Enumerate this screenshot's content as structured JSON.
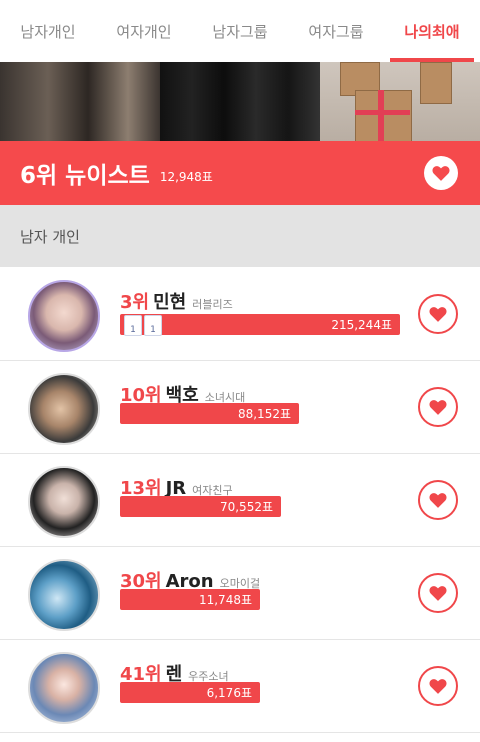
{
  "tabs": [
    {
      "label": "남자개인",
      "active": false
    },
    {
      "label": "여자개인",
      "active": false
    },
    {
      "label": "남자그룹",
      "active": false
    },
    {
      "label": "여자그룹",
      "active": false
    },
    {
      "label": "나의최애",
      "active": true
    }
  ],
  "hero": {
    "rank_name": "6위 뉴이스트",
    "votes": "12,948표"
  },
  "section": {
    "title": "남자 개인"
  },
  "badges": [
    "1",
    "1"
  ],
  "rows": [
    {
      "rank": "3위",
      "name": "민현",
      "group": "러블리즈",
      "votes": "215,244표",
      "bar_fraction": 1.0
    },
    {
      "rank": "10위",
      "name": "백호",
      "group": "소녀시대",
      "votes": "88,152표",
      "bar_fraction": 0.41
    },
    {
      "rank": "13위",
      "name": "JR",
      "group": "여자친구",
      "votes": "70,552표",
      "bar_fraction": 0.33
    },
    {
      "rank": "30위",
      "name": "Aron",
      "group": "오마이걸",
      "votes": "11,748표",
      "bar_fraction": 0.055
    },
    {
      "rank": "41위",
      "name": "렌",
      "group": "우주소녀",
      "votes": "6,176표",
      "bar_fraction": 0.029
    }
  ],
  "colors": {
    "accent": "#f0474a",
    "hero_bg": "#f54a4c",
    "section_bg": "#e3e3e3"
  }
}
